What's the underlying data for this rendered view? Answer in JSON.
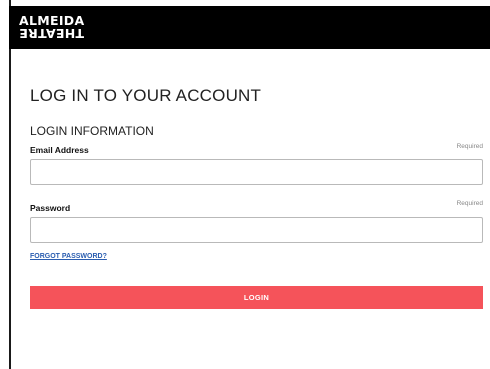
{
  "header": {
    "logo_line1": "ALMEIDA",
    "logo_line2": "THEATRE"
  },
  "main": {
    "page_title": "LOG IN TO YOUR ACCOUNT",
    "section_title": "LOGIN INFORMATION",
    "email": {
      "label": "Email Address",
      "required": "Required",
      "value": "",
      "placeholder": ""
    },
    "password": {
      "label": "Password",
      "required": "Required",
      "value": "",
      "placeholder": ""
    },
    "forgot_password": "FORGOT PASSWORD?",
    "login_button": "LOGIN"
  },
  "colors": {
    "header_bg": "#000000",
    "login_button_bg": "#f5535a",
    "link": "#2a5db0"
  }
}
